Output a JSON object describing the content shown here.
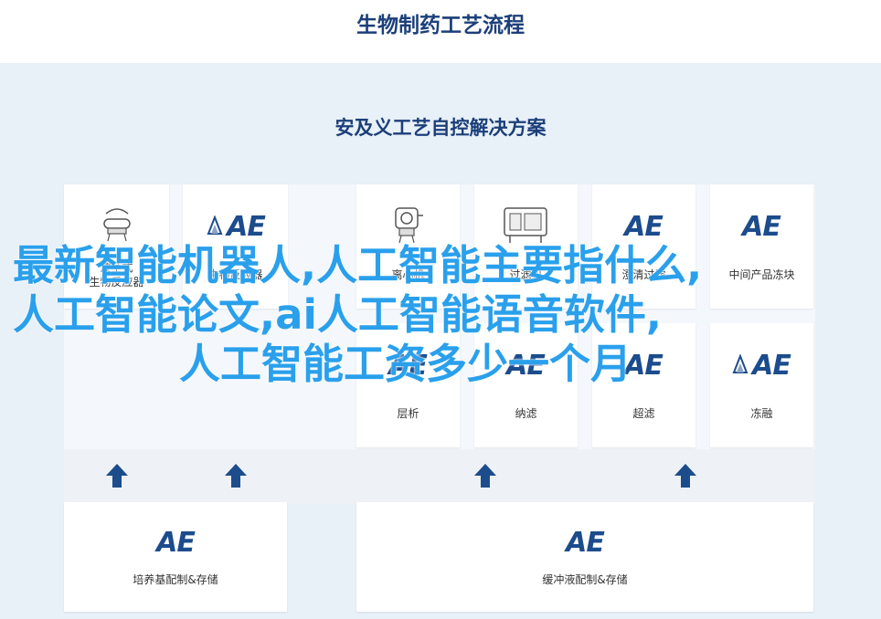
{
  "header": {
    "title": "生物制药工艺流程"
  },
  "panel": {
    "title": "安及义工艺自控解决方案"
  },
  "stage_cards": [
    {
      "label_line1": "波茎式",
      "label_line2": "生物反应器",
      "icon": "bioreactor-icon"
    },
    {
      "label": "生物反应器",
      "icon": "ae-logo-icon"
    },
    {
      "label": "离心机",
      "icon": "centrifuge-icon"
    },
    {
      "label": "过滤机",
      "icon": "filter-machine-icon"
    },
    {
      "label": "澄清过滤",
      "icon": "ae-logo-icon"
    },
    {
      "label": "中间产品冻块",
      "icon": "ae-logo-icon"
    },
    {
      "label": "层析",
      "icon": "ae-logo-icon"
    },
    {
      "label": "纳滤",
      "icon": "ae-logo-icon"
    },
    {
      "label": "超滤",
      "icon": "ae-logo-icon"
    },
    {
      "label": "冻融",
      "icon": "ae-logo-icon"
    }
  ],
  "bottom_cards": [
    {
      "label": "培养基配制&存储",
      "icon": "ae-logo-icon"
    },
    {
      "label": "缓冲液配制&存储",
      "icon": "ae-logo-icon"
    }
  ],
  "logo_text": "AE",
  "overlay": {
    "line1": "最新智能机器人,人工智能主要指什么,",
    "line2": "人工智能论文,ai人工智能语音软件,",
    "line3": "人工智能工资多少一个月"
  },
  "colors": {
    "brand_blue": "#1c4c8c",
    "title_navy": "#1c3f7a",
    "overlay_blue": "#2aa0ec",
    "panel_bg": "#e8f0f8"
  }
}
